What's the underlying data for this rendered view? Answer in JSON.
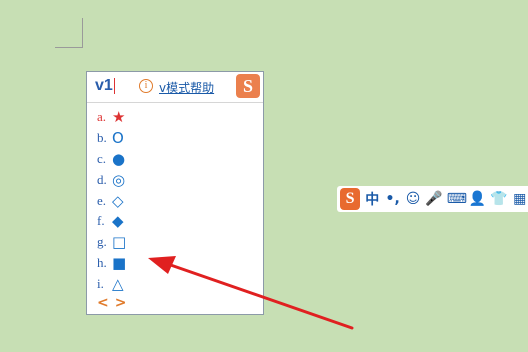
{
  "ime": {
    "input_text": "v1",
    "help_link": "v模式帮助",
    "logo_glyph": "S",
    "candidates": [
      {
        "index": "a.",
        "symbol": "★"
      },
      {
        "index": "b.",
        "symbol": "O"
      },
      {
        "index": "c.",
        "symbol": "●"
      },
      {
        "index": "d.",
        "symbol": "◎"
      },
      {
        "index": "e.",
        "symbol": "◇"
      },
      {
        "index": "f.",
        "symbol": "◆"
      },
      {
        "index": "g.",
        "symbol": "□"
      },
      {
        "index": "h.",
        "symbol": "■"
      },
      {
        "index": "i.",
        "symbol": "△"
      }
    ],
    "prev_page": "<",
    "next_page": ">"
  },
  "toolbar": {
    "logo_glyph": "S",
    "items": [
      {
        "label": "中",
        "icon": "chinese-mode-icon"
      },
      {
        "label": "•,",
        "icon": "punctuation-icon"
      },
      {
        "label": "☺",
        "icon": "emoji-icon"
      },
      {
        "label": "🎤",
        "icon": "microphone-icon"
      },
      {
        "label": "⌨",
        "icon": "keyboard-icon"
      },
      {
        "label": "👤",
        "icon": "user-icon"
      },
      {
        "label": "👕",
        "icon": "skin-icon"
      },
      {
        "label": "▦",
        "icon": "toolbox-icon"
      }
    ]
  },
  "colors": {
    "background": "#c7dfb4",
    "accent_orange": "#e86a2f",
    "candidate_blue": "#1a73c8",
    "highlight_red": "#dd3333",
    "arrow_red": "#e02020"
  }
}
